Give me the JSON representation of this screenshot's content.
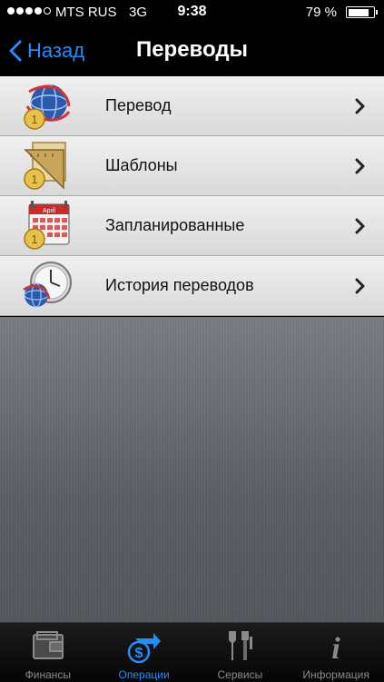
{
  "status_bar": {
    "carrier": "MTS RUS",
    "network": "3G",
    "time": "9:38",
    "battery": "79 %",
    "battery_level": 0.79
  },
  "nav": {
    "back_label": "Назад",
    "title": "Переводы"
  },
  "menu": {
    "items": [
      {
        "label": "Перевод",
        "icon": "globe-coin-icon"
      },
      {
        "label": "Шаблоны",
        "icon": "ruler-template-icon"
      },
      {
        "label": "Запланированные",
        "icon": "calendar-coin-icon"
      },
      {
        "label": "История переводов",
        "icon": "clock-globe-icon"
      }
    ],
    "calendar_month": "April"
  },
  "tabs": [
    {
      "label": "Финансы",
      "icon": "wallet-icon",
      "active": false
    },
    {
      "label": "Операции",
      "icon": "dollar-transfer-icon",
      "active": true
    },
    {
      "label": "Сервисы",
      "icon": "tools-icon",
      "active": false
    },
    {
      "label": "Информация",
      "icon": "info-icon",
      "active": false
    }
  ],
  "colors": {
    "accent": "#1e8fff",
    "inactive_tab": "#8a8a8a"
  }
}
